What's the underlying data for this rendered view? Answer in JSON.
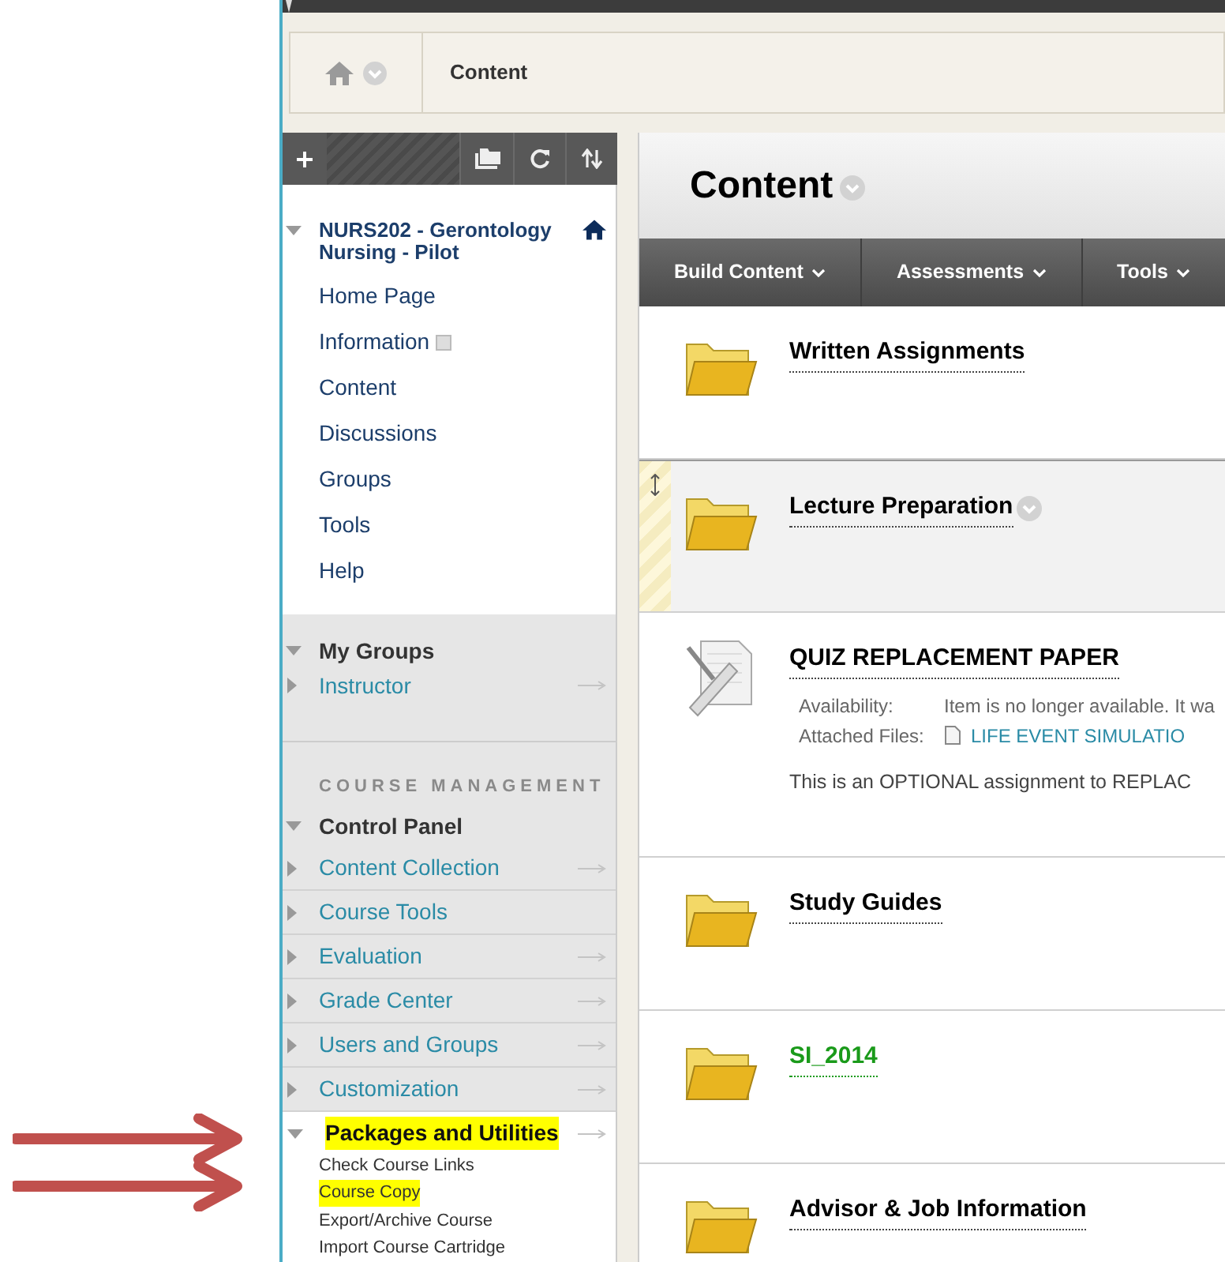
{
  "breadcrumb": {
    "label": "Content"
  },
  "course_menu": {
    "title": "NURS202 - Gerontology Nursing - Pilot",
    "expanded": true,
    "items": [
      {
        "label": "Home Page",
        "kind": "link"
      },
      {
        "label": "Information",
        "kind": "module"
      },
      {
        "label": "Content",
        "kind": "link"
      },
      {
        "label": "Discussions",
        "kind": "link"
      },
      {
        "label": "Groups",
        "kind": "link"
      },
      {
        "label": "Tools",
        "kind": "link"
      },
      {
        "label": "Help",
        "kind": "link"
      }
    ]
  },
  "my_groups": {
    "title": "My Groups",
    "expanded": true,
    "items": [
      {
        "label": "Instructor",
        "expanded": false,
        "submenu": true
      }
    ]
  },
  "course_management": {
    "heading": "COURSE MANAGEMENT",
    "control_panel": {
      "title": "Control Panel",
      "expanded": true,
      "items": [
        {
          "label": "Content Collection",
          "expanded": false,
          "submenu": true,
          "highlighted": false
        },
        {
          "label": "Course Tools",
          "expanded": false,
          "submenu": false,
          "highlighted": false
        },
        {
          "label": "Evaluation",
          "expanded": false,
          "submenu": true,
          "highlighted": false
        },
        {
          "label": "Grade Center",
          "expanded": false,
          "submenu": true,
          "highlighted": false
        },
        {
          "label": "Users and Groups",
          "expanded": false,
          "submenu": true,
          "highlighted": false
        },
        {
          "label": "Customization",
          "expanded": false,
          "submenu": true,
          "highlighted": false
        },
        {
          "label": "Packages and Utilities",
          "expanded": true,
          "submenu": true,
          "highlighted": true,
          "children": [
            {
              "label": "Check Course Links",
              "highlighted": false
            },
            {
              "label": "Course Copy",
              "highlighted": true
            },
            {
              "label": "Export/Archive Course",
              "highlighted": false
            },
            {
              "label": "Import Course Cartridge",
              "highlighted": false
            }
          ]
        }
      ]
    }
  },
  "content": {
    "title": "Content",
    "actions": [
      {
        "label": "Build Content"
      },
      {
        "label": "Assessments"
      },
      {
        "label": "Tools"
      }
    ],
    "items": [
      {
        "kind": "folder",
        "title": "Written Assignments",
        "hovered": false
      },
      {
        "kind": "folder",
        "title": "Lecture Preparation",
        "hovered": true
      },
      {
        "kind": "assignment",
        "title": "QUIZ REPLACEMENT PAPER",
        "hovered": false,
        "details": [
          {
            "label": "Availability:",
            "value": "Item is no longer available. It wa",
            "kind": "text"
          },
          {
            "label": "Attached Files:",
            "value": "LIFE EVENT SIMULATIO",
            "kind": "file"
          }
        ],
        "description": "This is an OPTIONAL assignment to REPLAC"
      },
      {
        "kind": "folder",
        "title": "Study Guides",
        "hovered": false
      },
      {
        "kind": "folder",
        "title": "SI_2014",
        "hovered": false,
        "color": "#1a9a1a"
      },
      {
        "kind": "folder",
        "title": "Advisor & Job Information",
        "hovered": false
      }
    ]
  }
}
